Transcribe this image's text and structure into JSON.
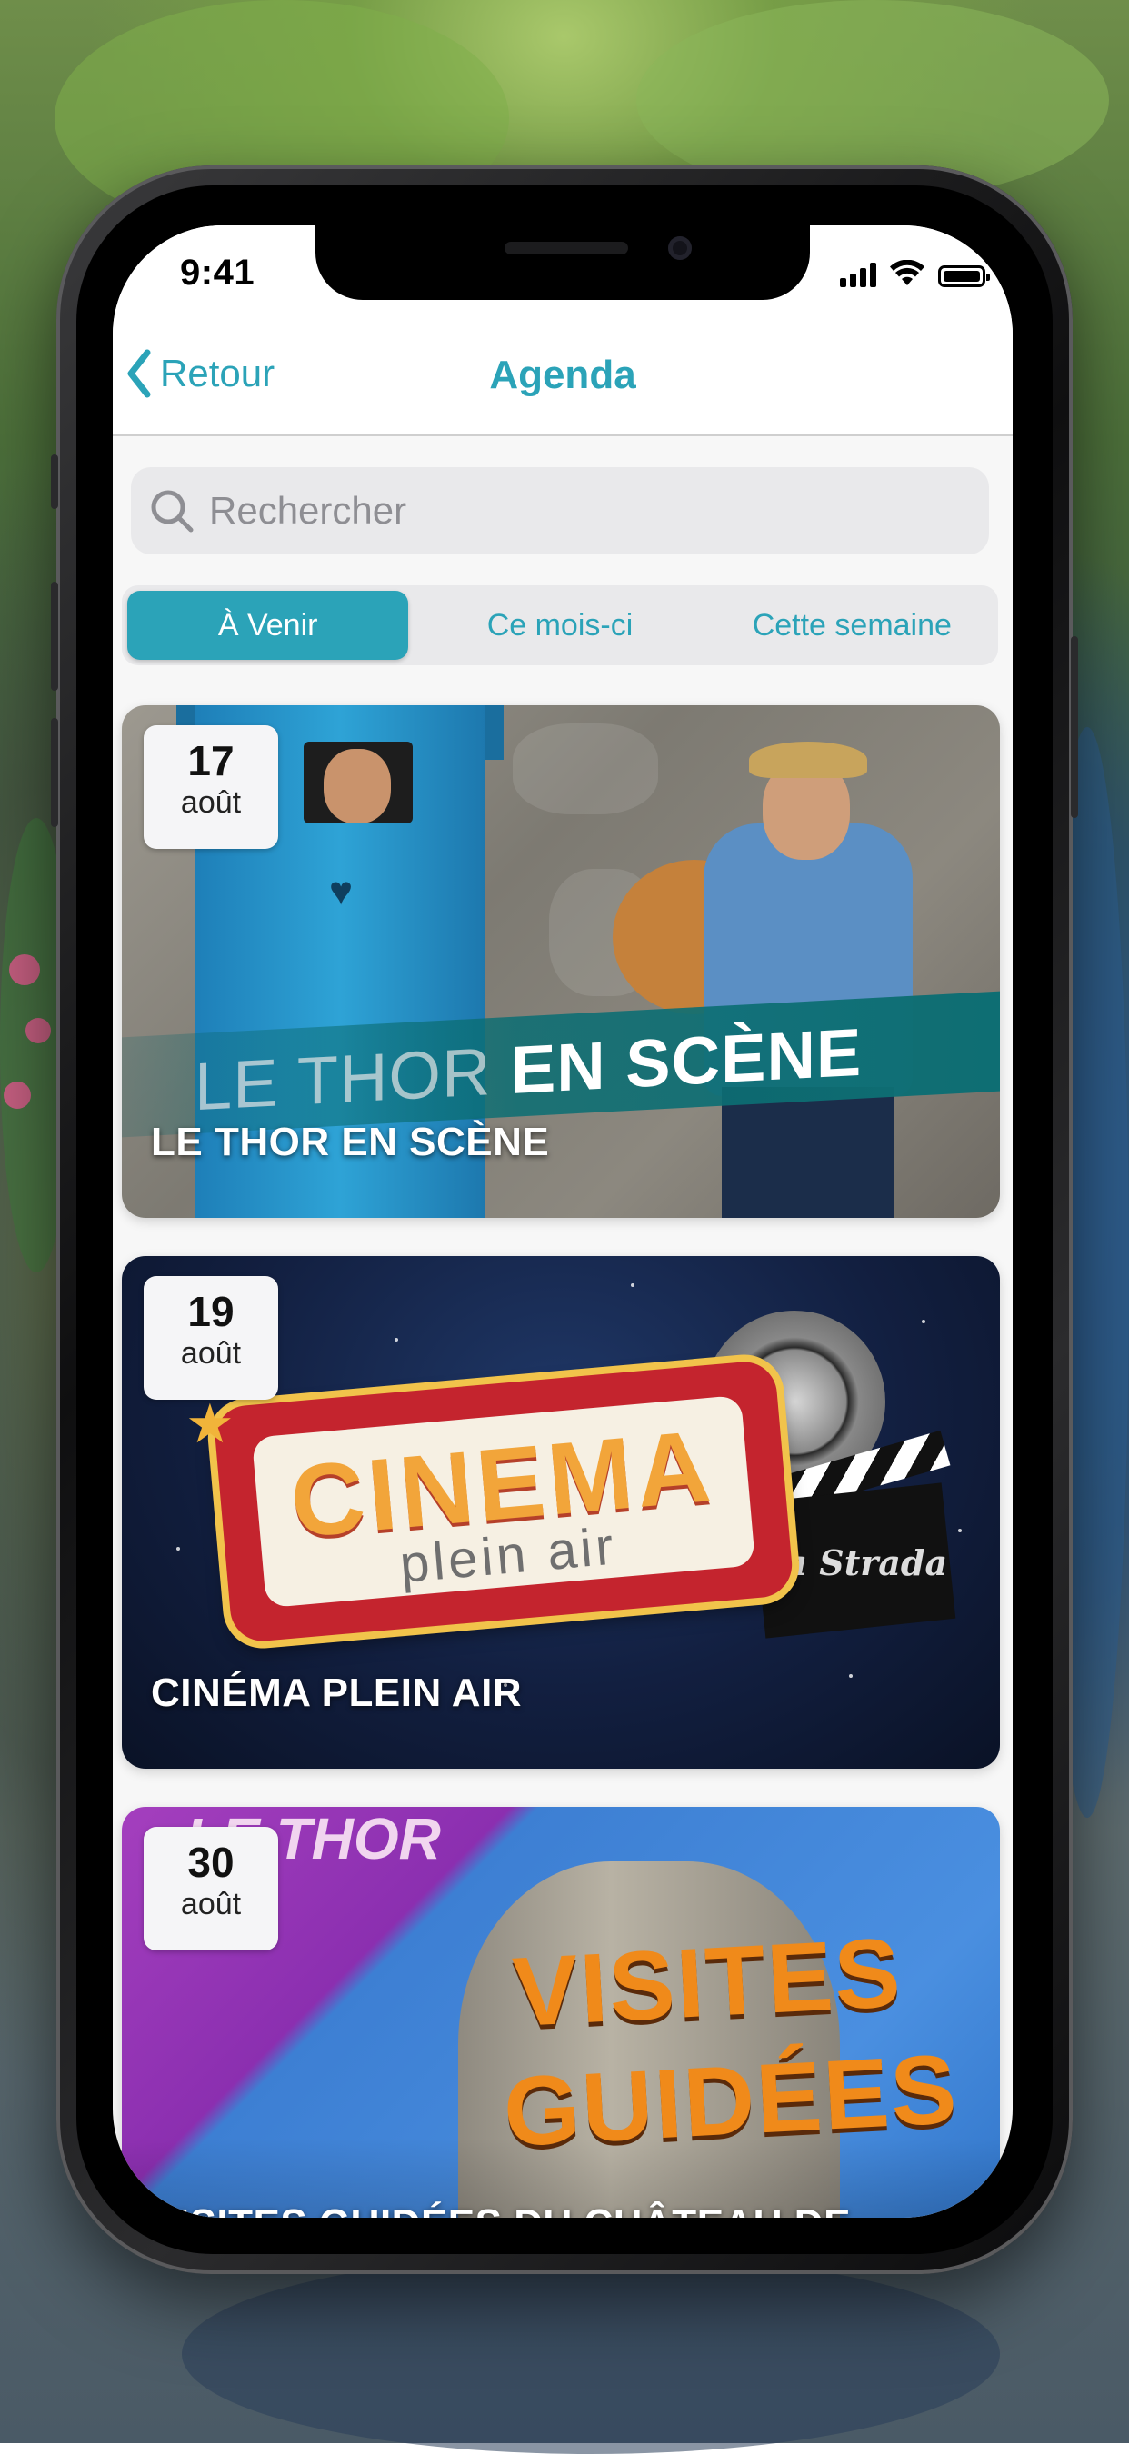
{
  "status_bar": {
    "time": "9:41"
  },
  "nav": {
    "back_label": "Retour",
    "title": "Agenda"
  },
  "search": {
    "placeholder": "Rechercher",
    "value": ""
  },
  "segments": {
    "items": [
      {
        "label": "À Venir",
        "active": true
      },
      {
        "label": "Ce mois-ci",
        "active": false
      },
      {
        "label": "Cette semaine",
        "active": false
      }
    ]
  },
  "events": [
    {
      "title": "LE THOR EN SCÈNE",
      "day": "17",
      "month": "août",
      "banner_text_light": "LE THOR ",
      "banner_text_bold": "EN SCÈNE"
    },
    {
      "title": "CINÉMA PLEIN AIR",
      "day": "19",
      "month": "août",
      "sign_main": "CINEMA",
      "sign_sub": "plein air",
      "brand": "la Strada"
    },
    {
      "title": "VISITES GUIDÉES DU CHÂTEAU DE",
      "day": "30",
      "month": "août",
      "header_text": "LE THOR",
      "art_line1": "VISITES",
      "art_line2": "GUIDÉES"
    }
  ],
  "colors": {
    "accent": "#2ba3b8",
    "segment_bg": "#e9e9eb",
    "screen_bg": "#f7f7f7"
  }
}
